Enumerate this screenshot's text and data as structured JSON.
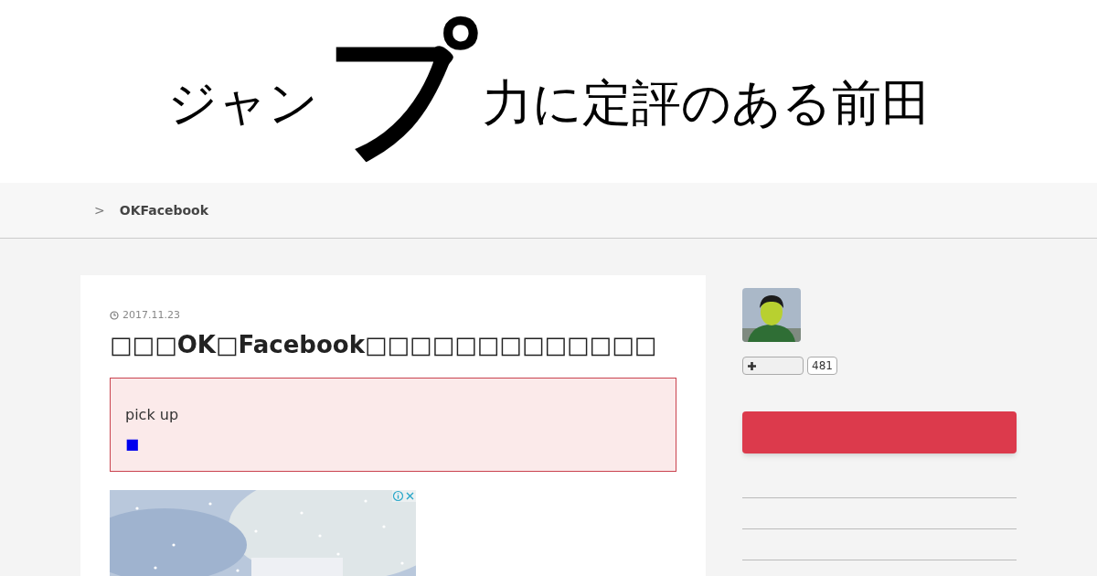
{
  "logo": {
    "before": "ジャン",
    "big": "プ",
    "after": "力に定評のある前田"
  },
  "breadcrumb": {
    "separator": ">",
    "current": "OKFacebook"
  },
  "article": {
    "date": "2017.11.23",
    "title": "□□□OK□Facebook□□□□□□□□□□□□□",
    "pickup": {
      "label": "pick up",
      "mark": "■"
    }
  },
  "sidebar": {
    "follow": {
      "count": "481"
    }
  }
}
